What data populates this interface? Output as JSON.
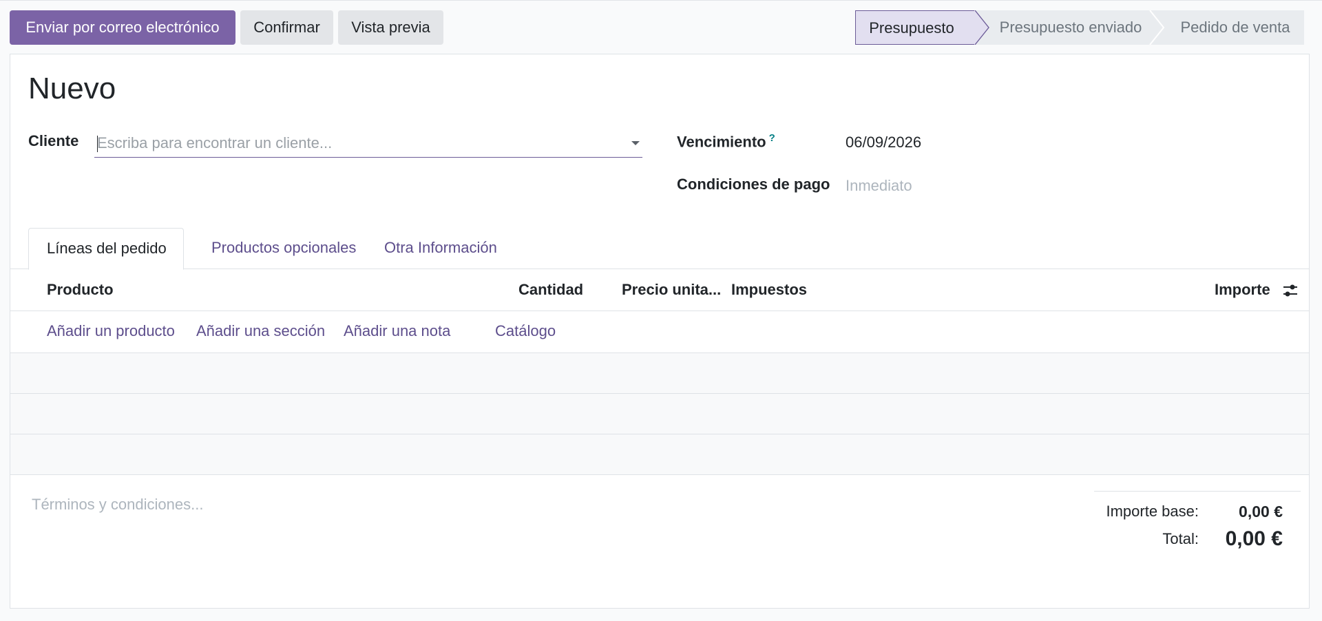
{
  "toolbar": {
    "send_email": "Enviar por correo electrónico",
    "confirm": "Confirmar",
    "preview": "Vista previa"
  },
  "statusbar": {
    "stages": [
      "Presupuesto",
      "Presupuesto enviado",
      "Pedido de venta"
    ],
    "active": "Presupuesto"
  },
  "record": {
    "title": "Nuevo",
    "customer_label": "Cliente",
    "customer_placeholder": "Escriba para encontrar un cliente...",
    "customer_value": "",
    "expiration_label": "Vencimiento",
    "expiration_help": "?",
    "expiration_value": "06/09/2026",
    "payment_terms_label": "Condiciones de pago",
    "payment_terms_placeholder": "Inmediato"
  },
  "tabs": [
    "Líneas del pedido",
    "Productos opcionales",
    "Otra Información"
  ],
  "table": {
    "headers": {
      "product": "Producto",
      "quantity": "Cantidad",
      "unit_price": "Precio unita...",
      "taxes": "Impuestos",
      "amount": "Importe"
    },
    "add_links": {
      "product": "Añadir un producto",
      "section": "Añadir una sección",
      "note": "Añadir una nota",
      "catalog": "Catálogo"
    }
  },
  "terms": {
    "placeholder": "Términos y condiciones..."
  },
  "totals": {
    "base_label": "Importe base:",
    "base_value": "0,00 €",
    "total_label": "Total:",
    "total_value": "0,00 €"
  },
  "colors": {
    "primary": "#7b63a6",
    "link": "#5d4e8c",
    "status_active_bg": "#e2dff0"
  }
}
